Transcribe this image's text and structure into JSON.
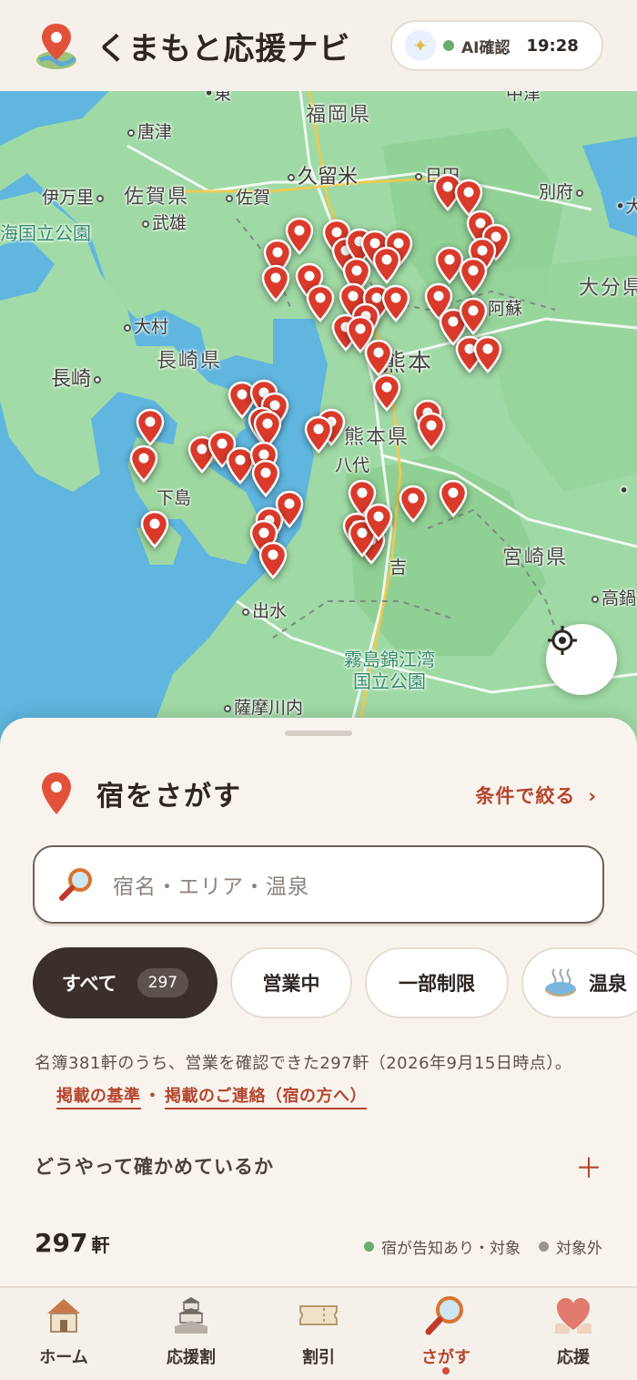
{
  "header": {
    "app_title": "くまもと応援ナビ",
    "status_label": "AI確認",
    "time": "19:28",
    "status_color": "#6bab72"
  },
  "map": {
    "labels": {
      "fukuoka": "福岡県",
      "karatsu": "唐津",
      "kurume": "久留米",
      "hita": "日田",
      "beppu": "別府",
      "imari": "伊万里",
      "saga_pref": "佐賀県",
      "saga": "佐賀",
      "takeo": "武雄",
      "kaiko": "海国立公園",
      "oita": "大分県",
      "omura": "大村",
      "nagasaki_pref": "長崎県",
      "nagasaki": "長崎",
      "aso": "阿蘇",
      "kumamoto": "熊本",
      "kumamoto_pref": "熊本県",
      "yatsushiro": "八代",
      "shimoshima": "下島",
      "hitoyoshi": "吉",
      "miyazaki_pref": "宮崎県",
      "takanabe": "高鍋",
      "izumi": "出水",
      "kirishima": "霧島錦江湾",
      "kirishima2": "国立公園",
      "satsumasendai": "薩摩川内"
    },
    "pin_color": "#d93a2b",
    "locate_icon": "crosshair-icon"
  },
  "sheet": {
    "title": "宿をさがす",
    "filter_link": "条件で絞る",
    "search_placeholder": "宿名・エリア・温泉",
    "chips": {
      "all": "すべて",
      "all_count": "297",
      "open": "営業中",
      "partial": "一部制限",
      "onsen": "温泉"
    },
    "notice_text": "名簿381軒のうち、営業を確認できた297軒（2026年9月15日時点）。",
    "link_criteria": "掲載の基準",
    "link_separator": "・",
    "link_contact": "掲載のご連絡（宿の方へ）",
    "how_label": "どうやって確かめているか",
    "how_toggle": "＋",
    "count_number": "297",
    "count_unit": "軒",
    "legend_target": "宿が告知あり・対象",
    "legend_other": "対象外",
    "legend_target_color": "#6bab72",
    "legend_other_color": "#9a948e"
  },
  "nav": {
    "home": "ホーム",
    "support_discount": "応援割",
    "discount": "割引",
    "search": "さがす",
    "support": "応援"
  }
}
